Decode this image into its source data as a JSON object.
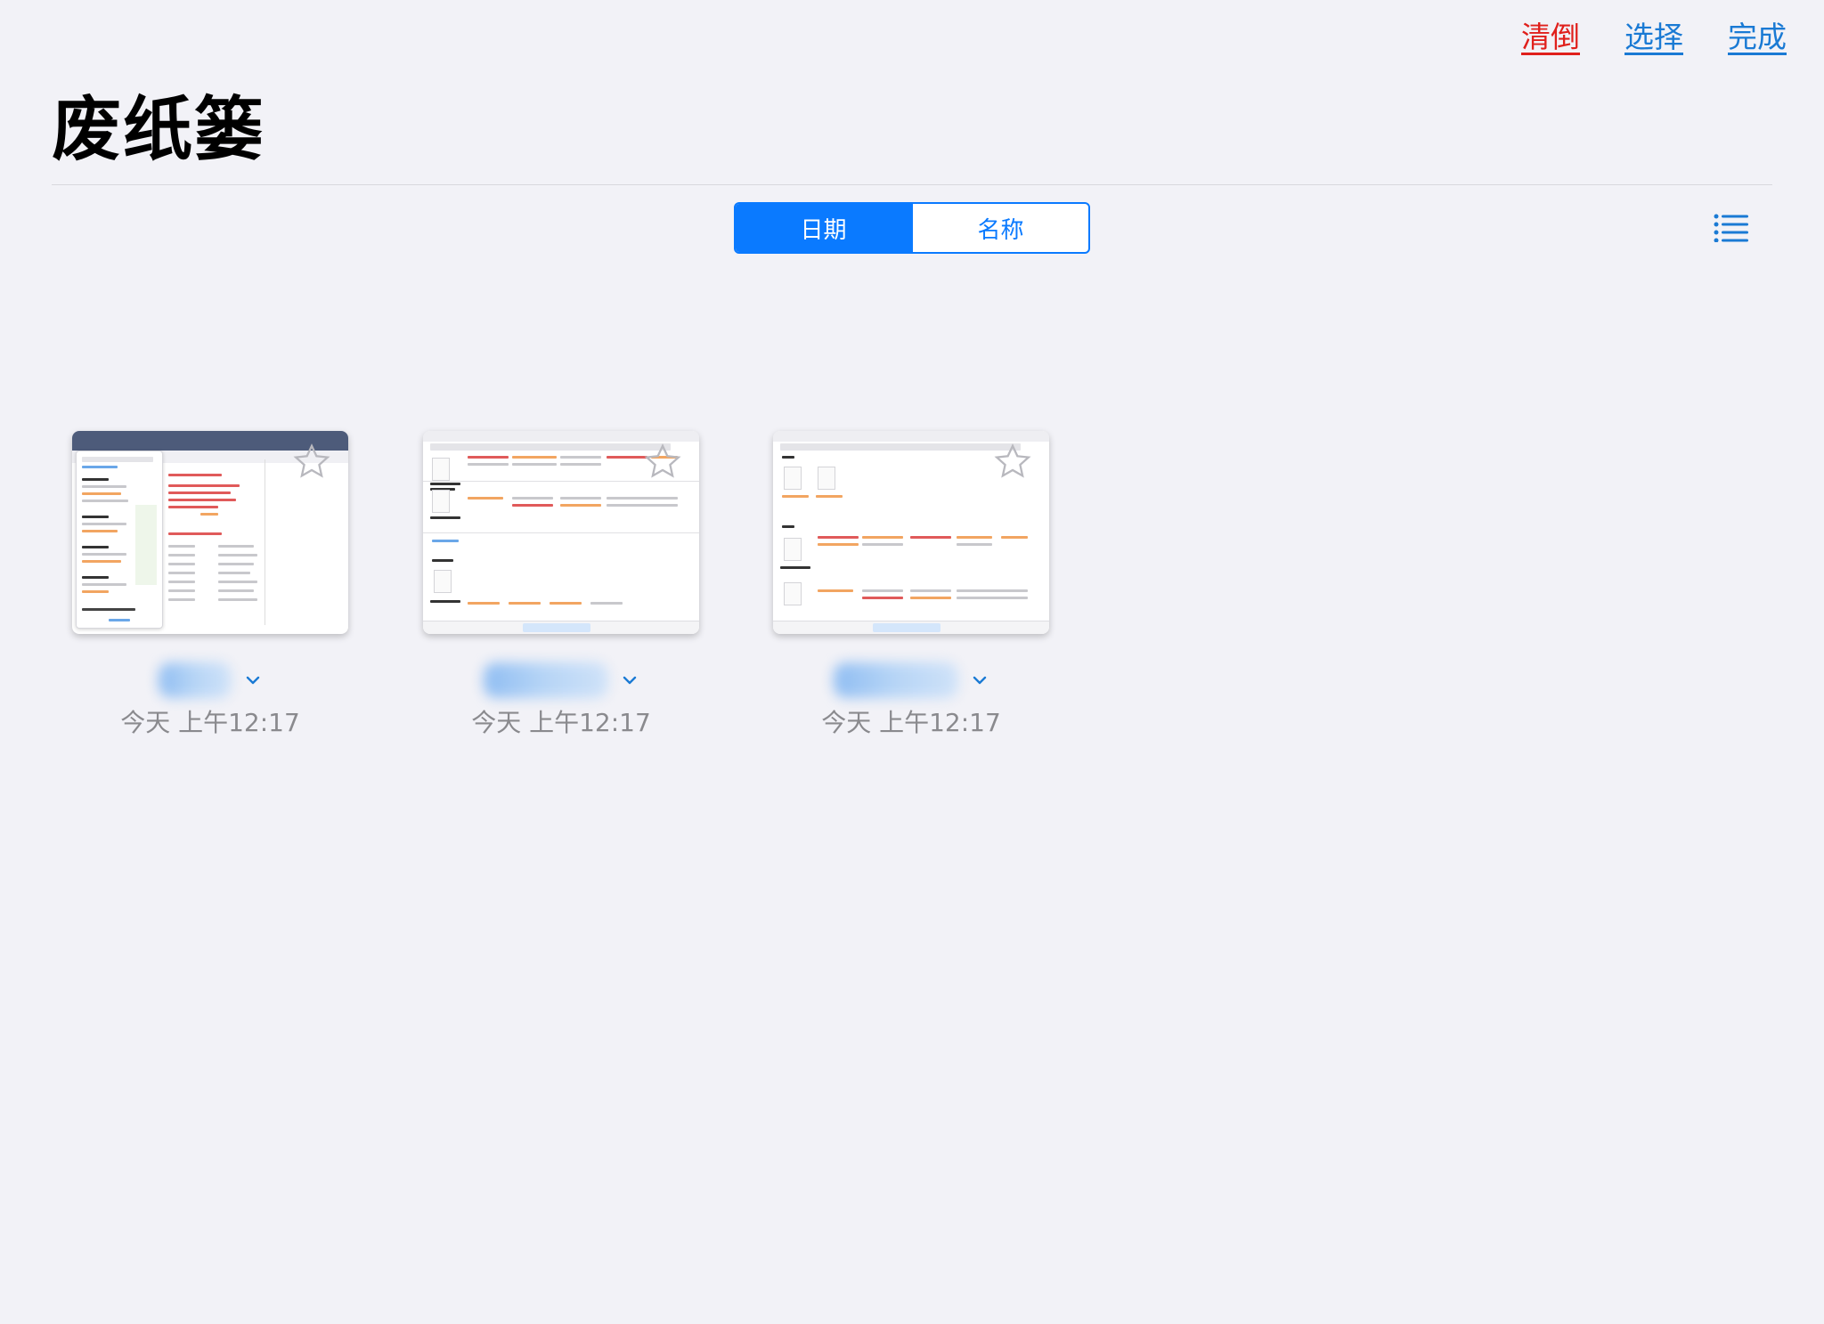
{
  "nav": {
    "empty_label": "清倒",
    "select_label": "选择",
    "done_label": "完成"
  },
  "page_title": "废纸篓",
  "sort": {
    "options": [
      "日期",
      "名称"
    ],
    "selected": "日期"
  },
  "files": [
    {
      "date": "今天 上午12:17"
    },
    {
      "date": "今天 上午12:17"
    },
    {
      "date": "今天 上午12:17"
    }
  ],
  "colors": {
    "accent": "#0a7aff",
    "destructive": "#e0201c",
    "background": "#f2f2f7"
  },
  "icons": {
    "list_view": "list-icon",
    "chevron": "chevron-down-icon",
    "favorite": "star-icon"
  }
}
